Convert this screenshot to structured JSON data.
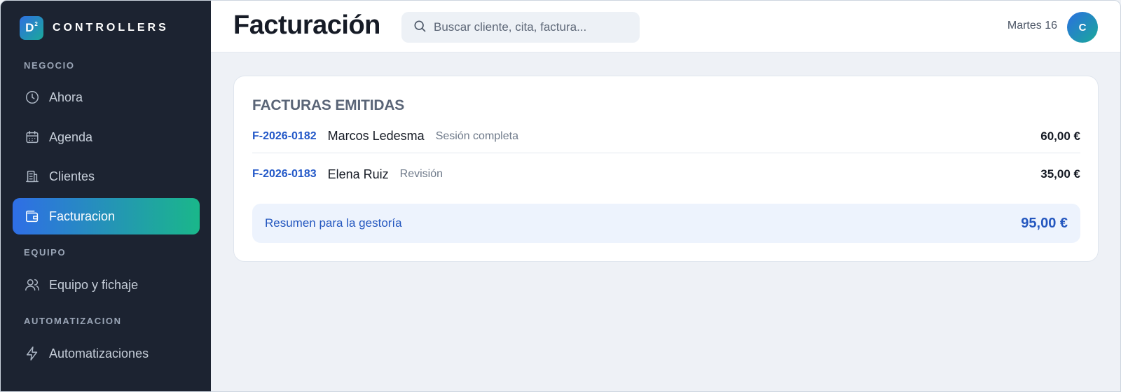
{
  "brand": {
    "logo_letter": "D",
    "logo_sup": "2",
    "name": "CONTROLLERS"
  },
  "sidebar": {
    "sections": [
      {
        "label": "NEGOCIO"
      },
      {
        "label": "EQUIPO"
      },
      {
        "label": "AUTOMATIZACION"
      }
    ],
    "items": [
      {
        "label": "Ahora",
        "icon": "clock-icon",
        "active": false
      },
      {
        "label": "Agenda",
        "icon": "calendar-icon",
        "active": false
      },
      {
        "label": "Clientes",
        "icon": "building-icon",
        "active": false
      },
      {
        "label": "Facturacion",
        "icon": "wallet-icon",
        "active": true
      },
      {
        "label": "Equipo y fichaje",
        "icon": "users-icon",
        "active": false
      },
      {
        "label": "Automatizaciones",
        "icon": "lightning-icon",
        "active": false
      }
    ]
  },
  "header": {
    "title": "Facturación",
    "search_placeholder": "Buscar cliente, cita, factura...",
    "date": "Martes 16",
    "avatar_initial": "C"
  },
  "invoices": {
    "title": "FACTURAS EMITIDAS",
    "rows": [
      {
        "id": "F-2026-0182",
        "client": "Marcos Ledesma",
        "service": "Sesión completa",
        "amount": "60,00 €"
      },
      {
        "id": "F-2026-0183",
        "client": "Elena Ruiz",
        "service": "Revisión",
        "amount": "35,00 €"
      }
    ],
    "summary": {
      "label": "Resumen para la gestoría",
      "total": "95,00 €"
    }
  },
  "colors": {
    "sidebar_bg": "#1c2331",
    "accent_blue": "#2f6ee6",
    "accent_green": "#1ab78a",
    "link_blue": "#2459c8"
  }
}
